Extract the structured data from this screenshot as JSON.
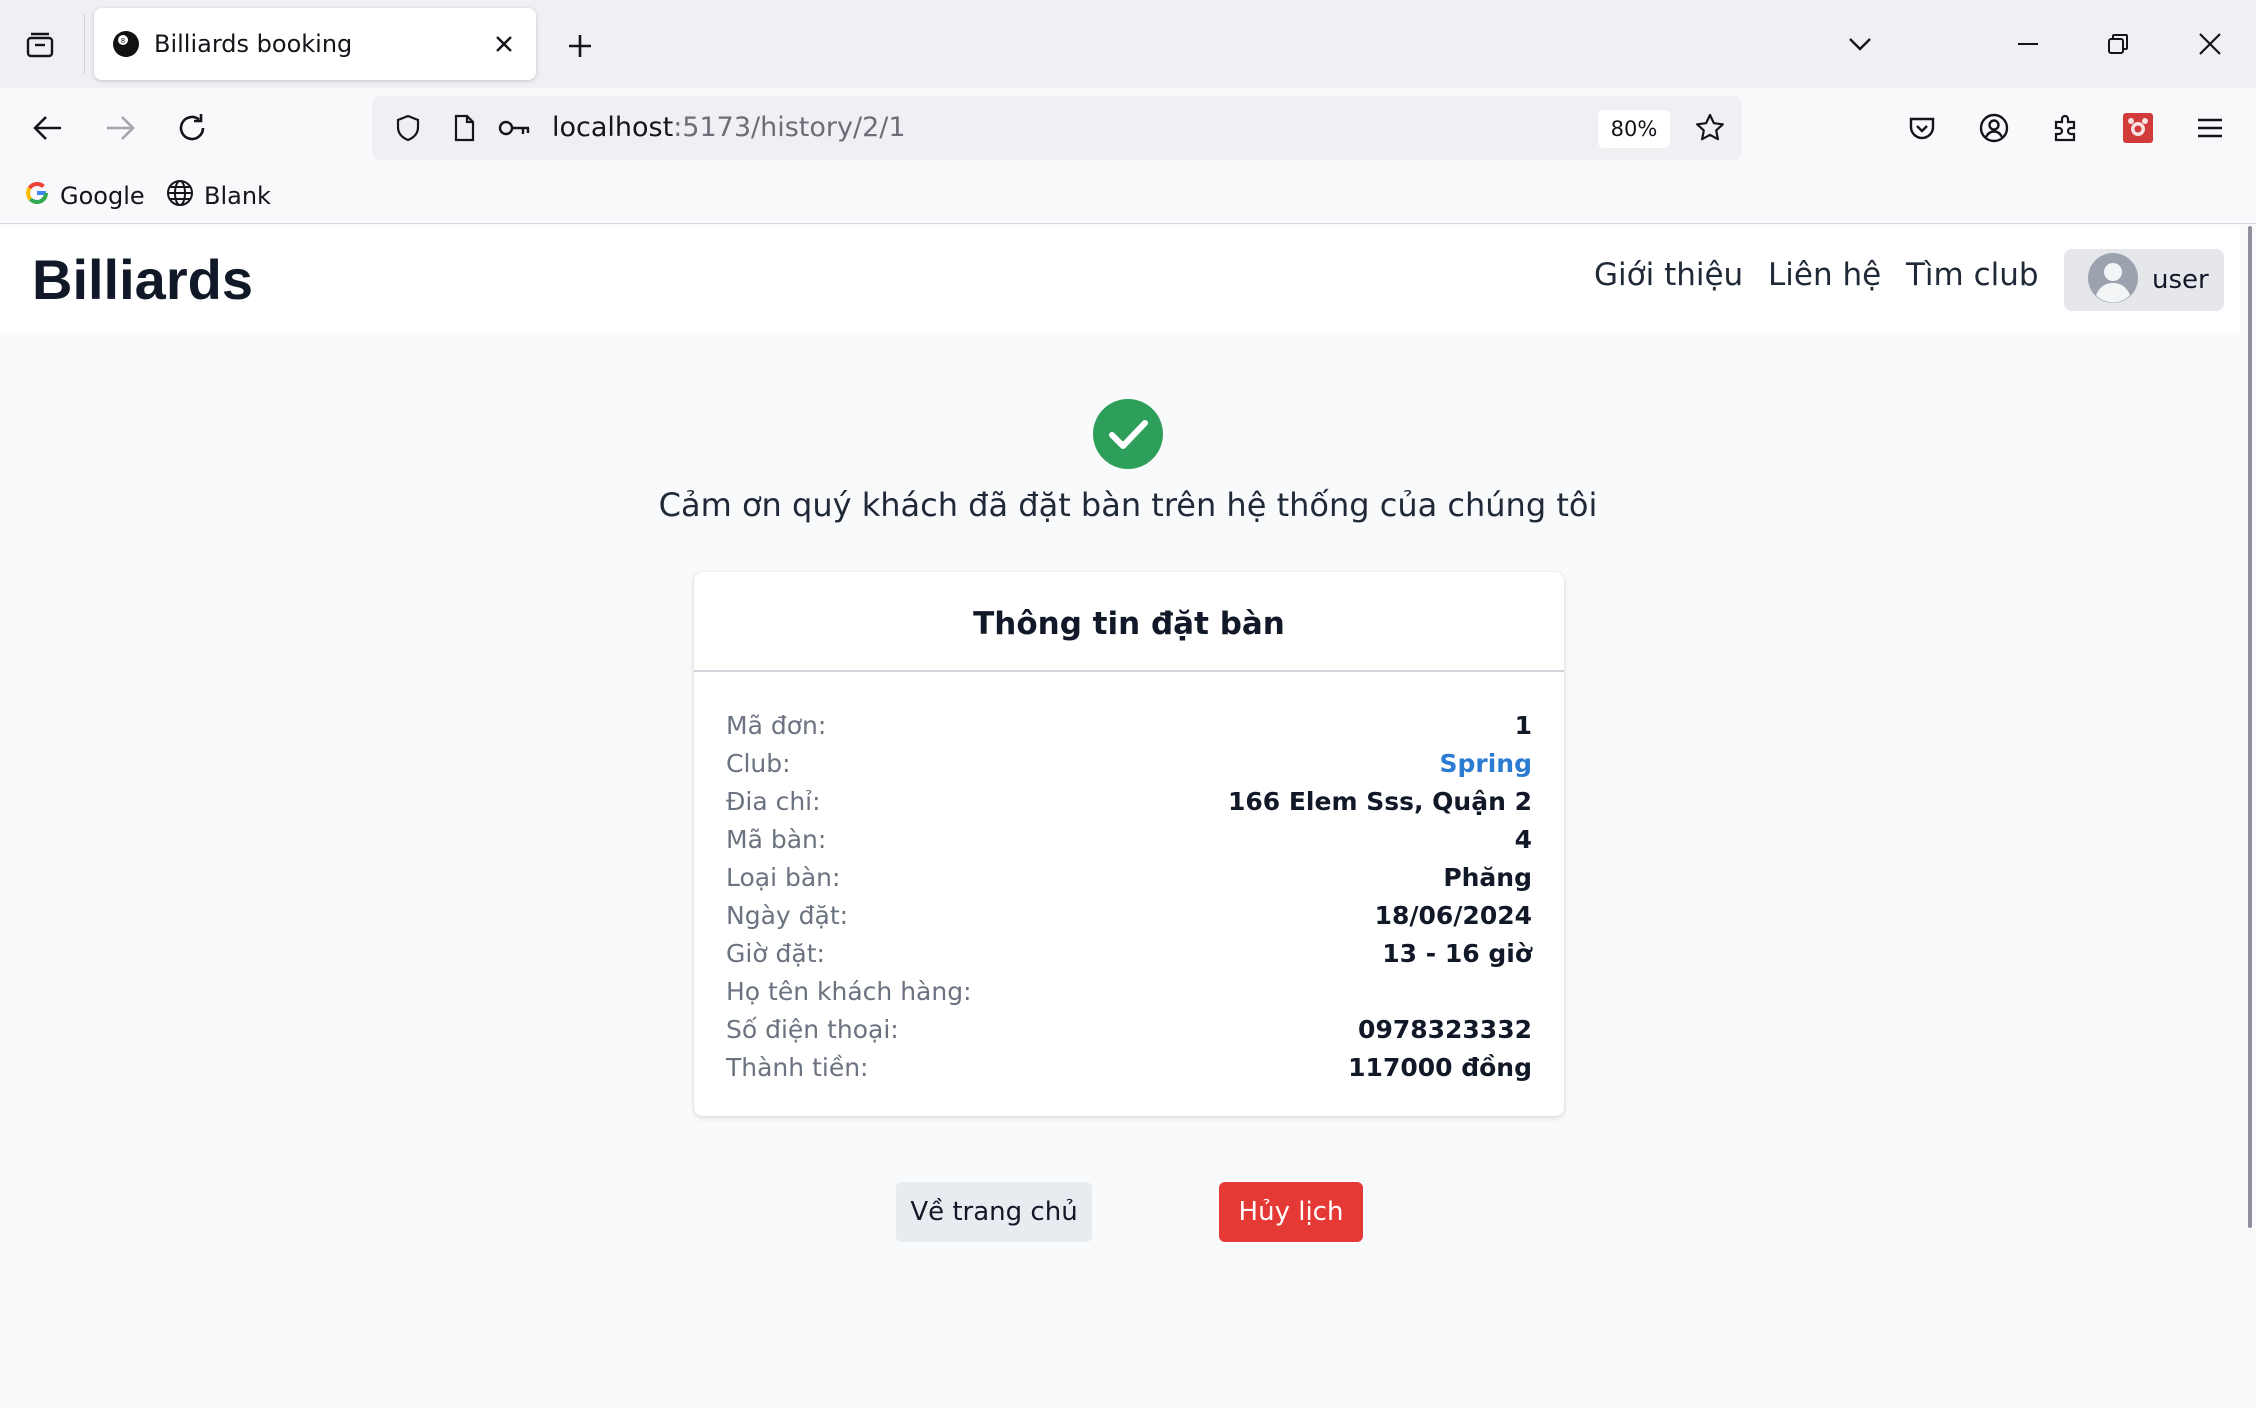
{
  "browser": {
    "tab_title": "Billiards booking",
    "url_host": "localhost",
    "url_path": ":5173/history/2/1",
    "zoom": "80%",
    "bookmarks": [
      {
        "label": "Google",
        "icon": "google-icon"
      },
      {
        "label": "Blank",
        "icon": "globe-icon"
      }
    ]
  },
  "header": {
    "brand": "Billiards",
    "nav": [
      "Giới thiệu",
      "Liên hệ",
      "Tìm club"
    ],
    "user": "user"
  },
  "confirmation": {
    "message": "Cảm ơn quý khách đã đặt bàn trên hệ thống của chúng tôi",
    "card_title": "Thông tin đặt bàn",
    "rows": [
      {
        "label": "Mã đơn:",
        "value": "1"
      },
      {
        "label": "Club:",
        "value": "Spring"
      },
      {
        "label": "Đia chỉ:",
        "value": "166 Elem Sss, Quận 2"
      },
      {
        "label": "Mã bàn:",
        "value": "4"
      },
      {
        "label": "Loại bàn:",
        "value": "Phăng"
      },
      {
        "label": "Ngày đặt:",
        "value": "18/06/2024"
      },
      {
        "label": "Giờ đặt:",
        "value": "13 - 16 giờ"
      },
      {
        "label": "Họ tên khách hàng:",
        "value": ""
      },
      {
        "label": "Số điện thoại:",
        "value": "0978323332"
      },
      {
        "label": "Thành tiền:",
        "value": "117000 đồng"
      }
    ]
  },
  "actions": {
    "home": "Về trang chủ",
    "cancel": "Hủy lịch"
  },
  "colors": {
    "success": "#2e9e5b",
    "cancel": "#e53935",
    "link": "#2b7bd0"
  }
}
